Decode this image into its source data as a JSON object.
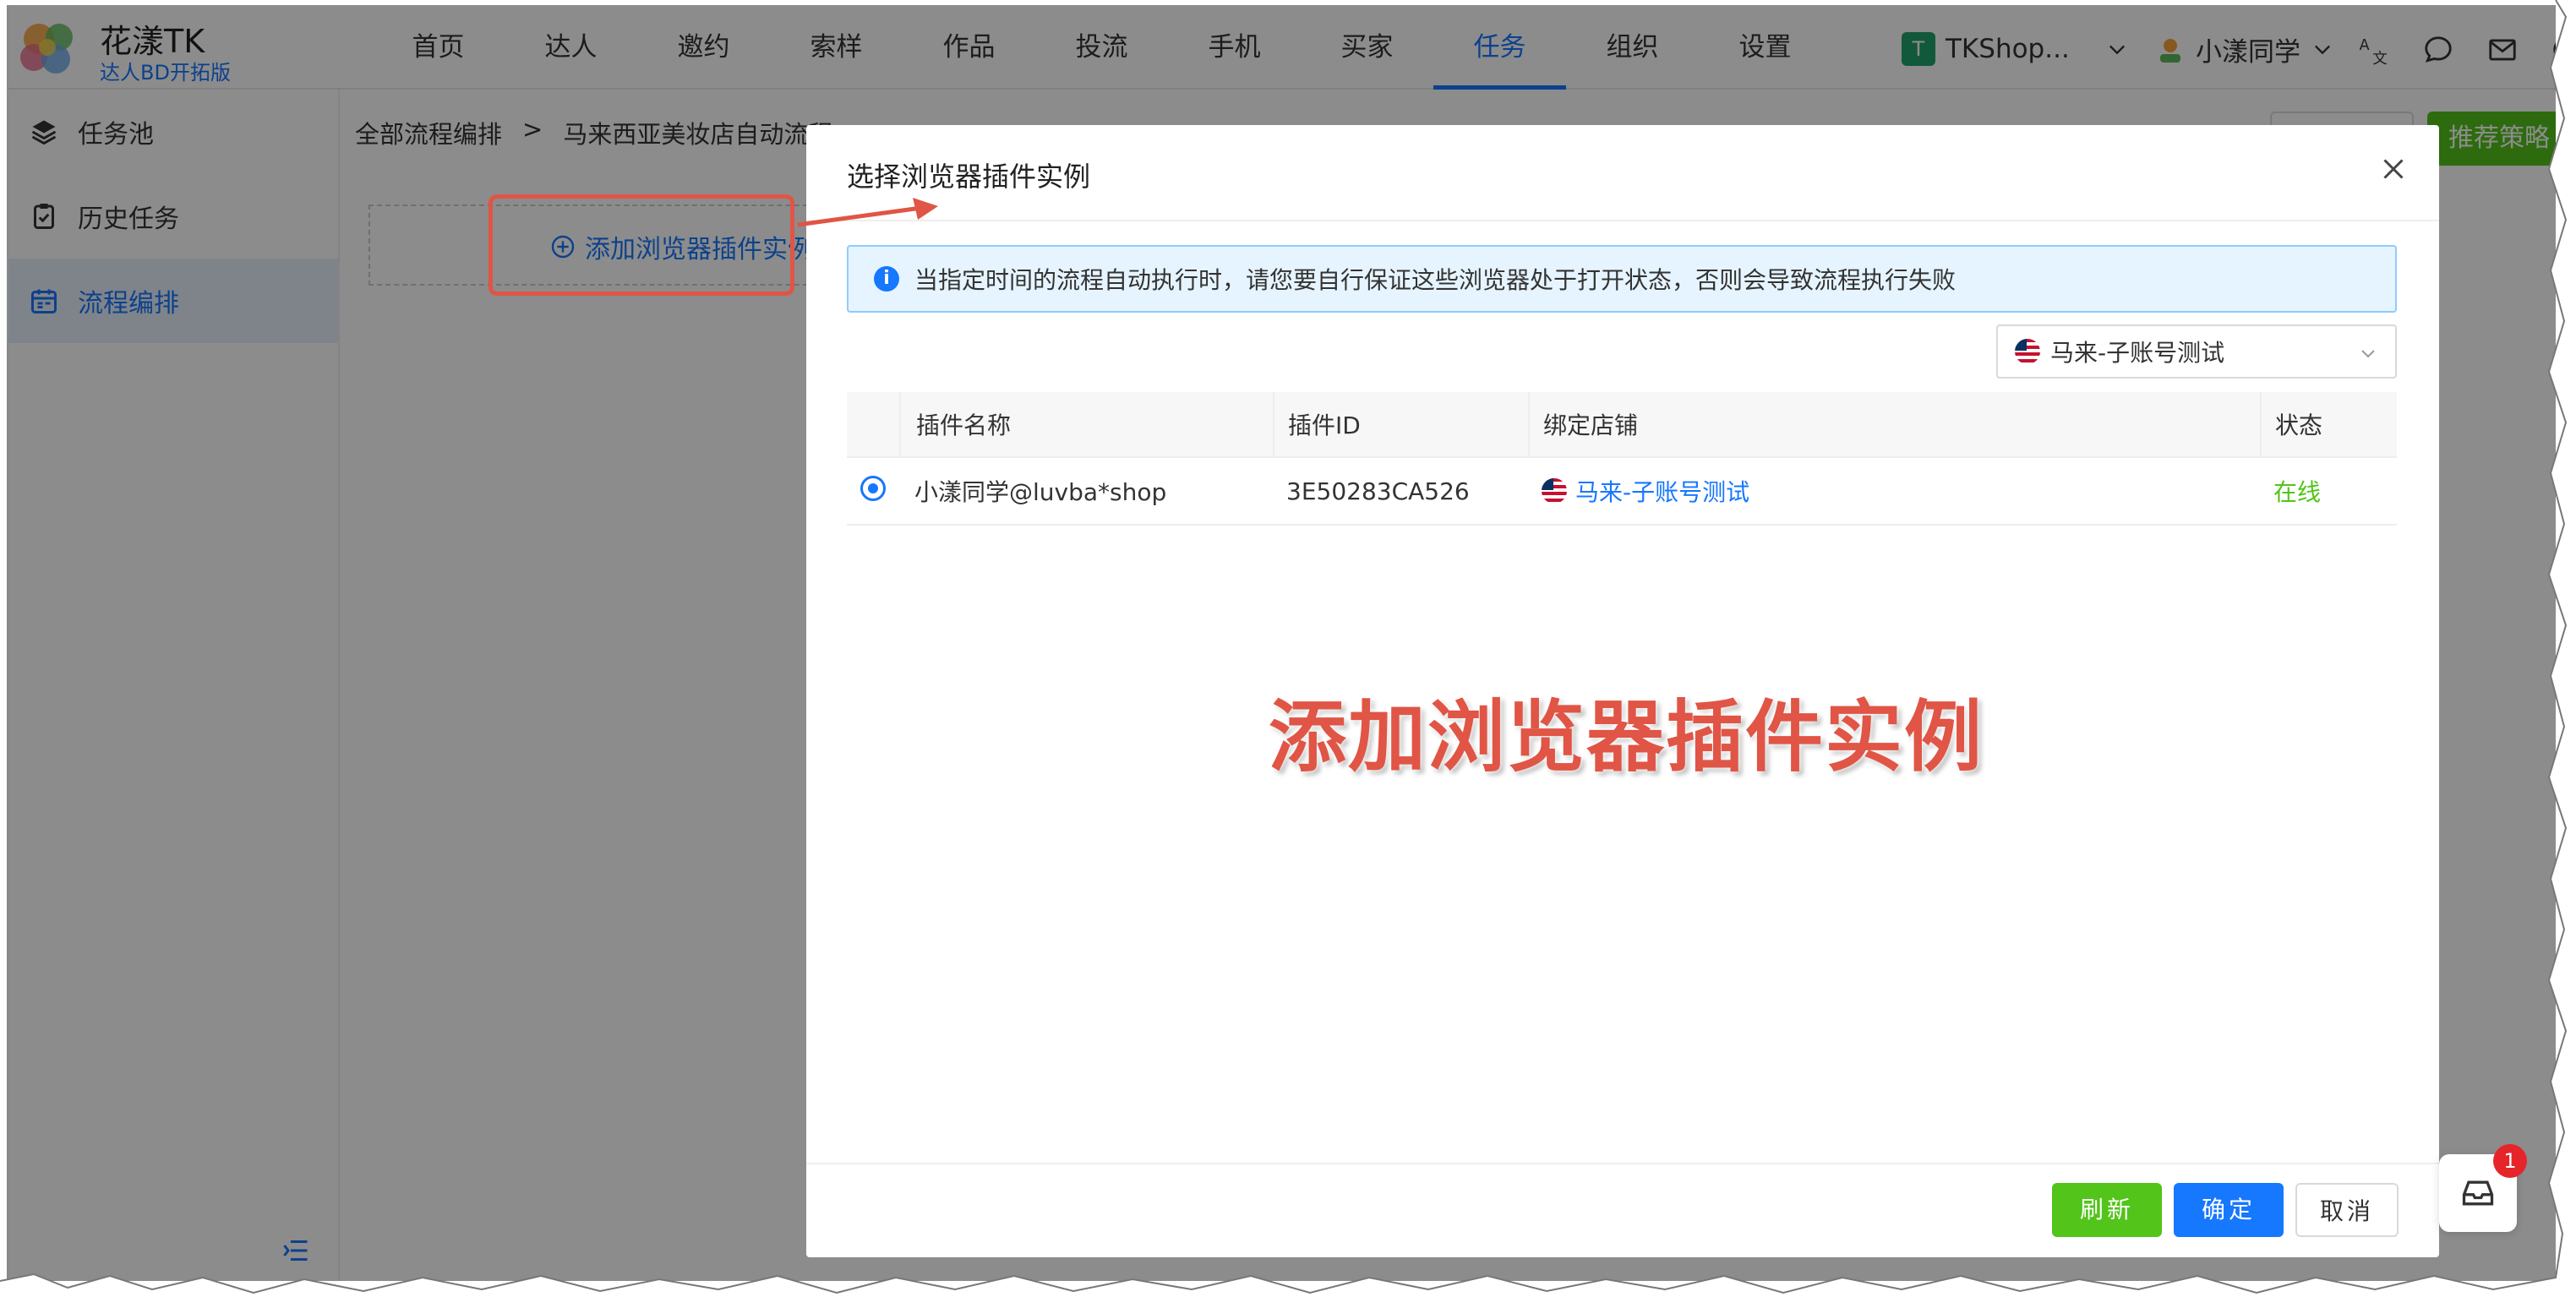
{
  "brand": {
    "name": "花漾TK",
    "subtitle": "达人BD开拓版"
  },
  "nav": [
    "首页",
    "达人",
    "邀约",
    "索样",
    "作品",
    "投流",
    "手机",
    "买家",
    "任务",
    "组织",
    "设置"
  ],
  "nav_active": "任务",
  "header": {
    "shop_initial": "T",
    "shop_name": "TKShop...",
    "user_name": "小漾同学"
  },
  "sidebar": {
    "items": [
      {
        "label": "任务池",
        "icon": "layers-icon"
      },
      {
        "label": "历史任务",
        "icon": "clipboard-check-icon"
      },
      {
        "label": "流程编排",
        "icon": "calendar-icon",
        "active": true
      }
    ]
  },
  "breadcrumb": {
    "root": "全部流程编排",
    "separator": ">",
    "current": "马来西亚美妆店自动流程"
  },
  "page": {
    "add_plugin_label": "添加浏览器插件实例",
    "recommend_button": "推荐策略"
  },
  "modal": {
    "title": "选择浏览器插件实例",
    "alert": "当指定时间的流程自动执行时，请您要自行保证这些浏览器处于打开状态，否则会导致流程执行失败",
    "shop_filter": "马来-子账号测试",
    "columns": [
      "插件名称",
      "插件ID",
      "绑定店铺",
      "状态"
    ],
    "rows": [
      {
        "name": "小漾同学@luvba*shop",
        "plugin_id": "3E50283CA526",
        "shop": "马来-子账号测试",
        "status": "在线",
        "selected": true
      }
    ],
    "buttons": {
      "refresh": "刷新",
      "ok": "确定",
      "cancel": "取消"
    }
  },
  "annotation": {
    "text": "添加浏览器插件实例",
    "color": "#e05545"
  },
  "notifications": {
    "badge_count": "1"
  },
  "colors": {
    "primary": "#1677ff",
    "success": "#52c41a",
    "annotation": "#e05545"
  }
}
